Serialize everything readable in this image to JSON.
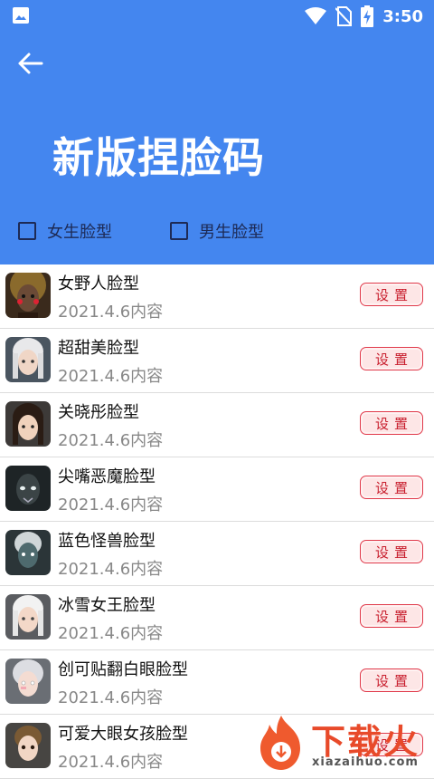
{
  "status_bar": {
    "time": "3:50",
    "left_icon": "image-icon",
    "right_icons": [
      "wifi-icon",
      "no-sim-icon",
      "battery-charging-icon"
    ]
  },
  "header": {
    "back_icon": "arrow-left-icon",
    "title": "新版捏脸码",
    "bg_color": "#4486ef"
  },
  "filters": [
    {
      "label": "女生脸型",
      "checked": false
    },
    {
      "label": "男生脸型",
      "checked": false
    }
  ],
  "list": {
    "button_label": "设置",
    "items": [
      {
        "name": "女野人脸型",
        "date": "2021.4.6内容"
      },
      {
        "name": "超甜美脸型",
        "date": "2021.4.6内容"
      },
      {
        "name": "关晓彤脸型",
        "date": "2021.4.6内容"
      },
      {
        "name": "尖嘴恶魔脸型",
        "date": "2021.4.6内容"
      },
      {
        "name": "蓝色怪兽脸型",
        "date": "2021.4.6内容"
      },
      {
        "name": "冰雪女王脸型",
        "date": "2021.4.6内容"
      },
      {
        "name": "创可贴翻白眼脸型",
        "date": "2021.4.6内容"
      },
      {
        "name": "可爱大眼女孩脸型",
        "date": "2021.4.6内容"
      }
    ]
  },
  "watermark": {
    "text": "下载火",
    "sub": "xiazaihuo.com"
  }
}
